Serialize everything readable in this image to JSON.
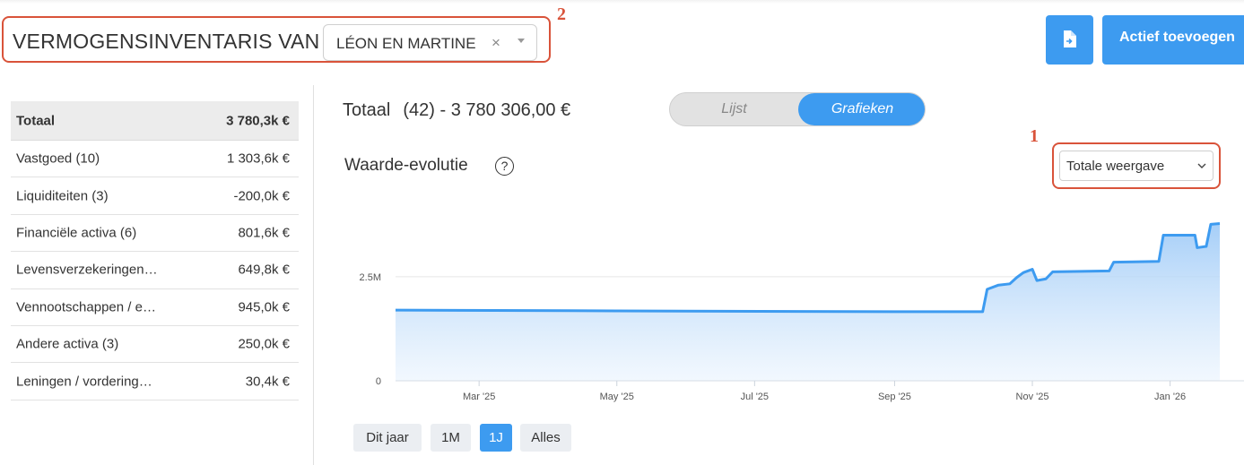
{
  "header": {
    "title": "VERMOGENSINVENTARIS VAN",
    "client_select": {
      "value": "LÉON EN MARTINE",
      "clear_glyph": "×"
    },
    "markers": {
      "top": "2",
      "view": "1"
    },
    "export_icon": "file-export-icon",
    "add_button_label": "Actief toevoegen"
  },
  "summary": {
    "total": {
      "label": "Totaal",
      "amount": "3 780,3k €"
    },
    "rows": [
      {
        "label": "Vastgoed (10)",
        "amount": "1 303,6k €"
      },
      {
        "label": "Liquiditeiten (3)",
        "amount": "-200,0k €"
      },
      {
        "label": "Financiële activa (6)",
        "amount": "801,6k €"
      },
      {
        "label": "Levensverzekeringen…",
        "amount": "649,8k €"
      },
      {
        "label": "Vennootschappen / e…",
        "amount": "945,0k €"
      },
      {
        "label": "Andere activa (3)",
        "amount": "250,0k €"
      },
      {
        "label": "Leningen / vordering…",
        "amount": "30,4k €"
      }
    ]
  },
  "main": {
    "total_label": "Totaal",
    "total_count_value": "(42) - 3 780 306,00 €",
    "toggle": {
      "list_label": "Lijst",
      "charts_label": "Grafieken",
      "active": "Grafieken"
    },
    "chart_title": "Waarde-evolutie",
    "help_glyph": "?",
    "view_select": "Totale weergave",
    "range_buttons": [
      {
        "label": "Dit jaar",
        "active": false
      },
      {
        "label": "1M",
        "active": false
      },
      {
        "label": "1J",
        "active": true
      },
      {
        "label": "Alles",
        "active": false
      }
    ]
  },
  "colors": {
    "accent": "#3d9bf0",
    "highlight": "#d9533a"
  },
  "chart_data": {
    "type": "area",
    "title": "Waarde-evolutie",
    "xlabel": "",
    "ylabel": "",
    "ylim": [
      0,
      4200000
    ],
    "xlim": [
      "2025-01-23",
      "2026-01-23"
    ],
    "grid": true,
    "legend": "none",
    "y_ticks": [
      {
        "value": 0,
        "label": "0"
      },
      {
        "value": 2500000,
        "label": "2.5M"
      }
    ],
    "x_ticks": [
      {
        "value": "2025-03-01",
        "label": "Mar '25"
      },
      {
        "value": "2025-05-01",
        "label": "May '25"
      },
      {
        "value": "2025-07-01",
        "label": "Jul '25"
      },
      {
        "value": "2025-09-01",
        "label": "Sep '25"
      },
      {
        "value": "2025-11-01",
        "label": "Nov '25"
      },
      {
        "value": "2026-01-01",
        "label": "Jan '26"
      }
    ],
    "series": [
      {
        "values": [
          [
            "2025-01-23",
            1700000
          ],
          [
            "2025-05-01",
            1680000
          ],
          [
            "2025-09-01",
            1660000
          ],
          [
            "2025-10-10",
            1660000
          ],
          [
            "2025-10-12",
            2200000
          ],
          [
            "2025-10-17",
            2300000
          ],
          [
            "2025-10-22",
            2330000
          ],
          [
            "2025-10-25",
            2480000
          ],
          [
            "2025-10-28",
            2600000
          ],
          [
            "2025-11-01",
            2680000
          ],
          [
            "2025-11-03",
            2410000
          ],
          [
            "2025-11-07",
            2450000
          ],
          [
            "2025-11-10",
            2620000
          ],
          [
            "2025-12-05",
            2640000
          ],
          [
            "2025-12-07",
            2850000
          ],
          [
            "2025-12-27",
            2870000
          ],
          [
            "2025-12-29",
            3500000
          ],
          [
            "2026-01-12",
            3500000
          ],
          [
            "2026-01-13",
            3200000
          ],
          [
            "2026-01-17",
            3230000
          ],
          [
            "2026-01-19",
            3760000
          ],
          [
            "2026-01-23",
            3780000
          ]
        ]
      }
    ]
  }
}
